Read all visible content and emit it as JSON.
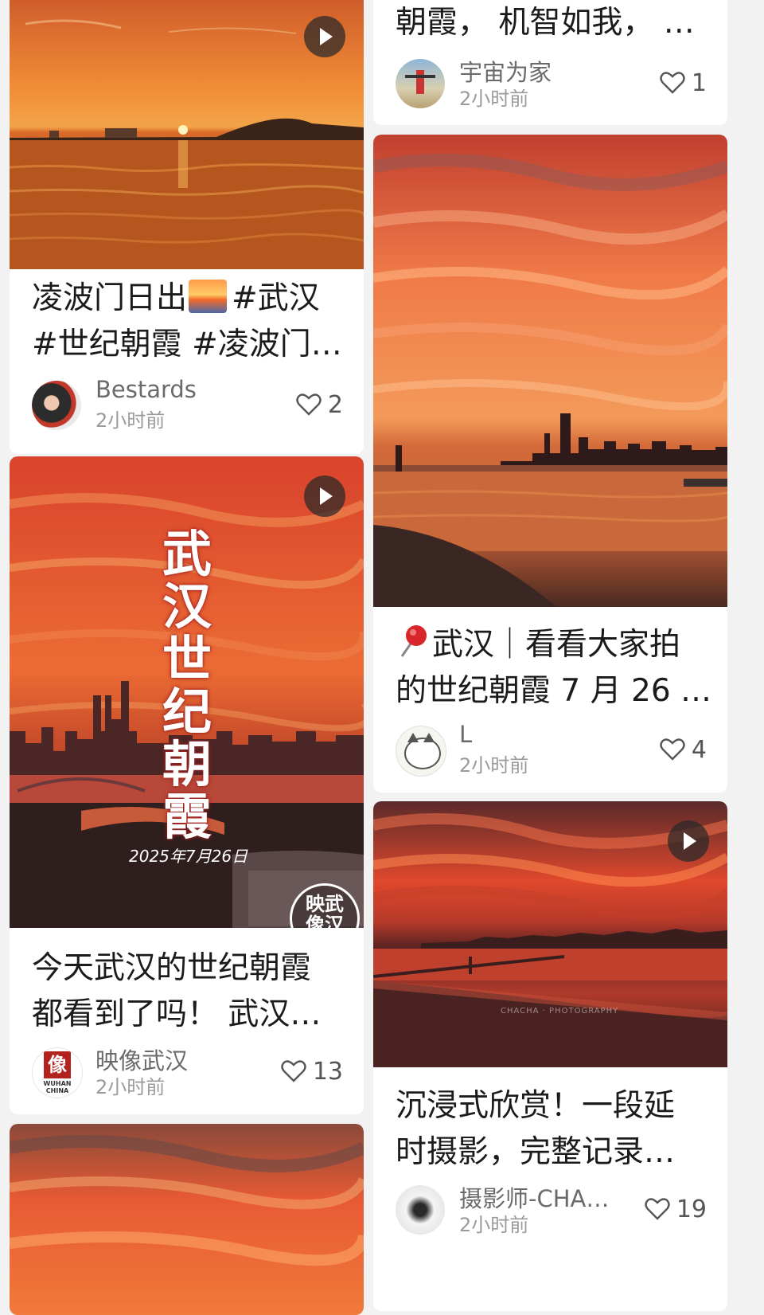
{
  "colors": {
    "background": "#f2f2f2",
    "card": "#ffffff",
    "text": "#1b1b1b",
    "meta": "#9a9a9a"
  },
  "cards": [
    {
      "title_line1": "凌波门日出",
      "title_line1b": "#武汉",
      "title_line2": "#世纪朝霞 #凌波门…",
      "author": "Bestards",
      "time": "2小时前",
      "likes": "2",
      "has_video": true
    },
    {
      "overlay_title": "武汉世纪朝霞",
      "overlay_date": "2025年7月26日",
      "watermark": "映武像汉",
      "title_line1": "今天武汉的世纪朝霞",
      "title_line2": "都看到了吗！ 武汉…",
      "author": "映像武汉",
      "avatar_text": "像",
      "avatar_caption": "WUHAN CHINA",
      "time": "2小时前",
      "likes": "13",
      "has_video": true
    },
    {
      "title_line1": "朝霞， 机智如我， …",
      "author": "宇宙为家",
      "time": "2小时前",
      "likes": "1"
    },
    {
      "title_line1": "武汉｜看看大家拍",
      "title_line2": "的世纪朝霞 7 月 26 …",
      "author": "L",
      "time": "2小时前",
      "likes": "4"
    },
    {
      "photo_watermark": "CHACHA · PHOTOGRAPHY",
      "title_line1": "沉浸式欣赏！一段延",
      "title_line2": "时摄影，完整记录…",
      "author": "摄影师-CHA…",
      "time": "2小时前",
      "likes": "19",
      "has_video": true
    }
  ],
  "icons": {
    "like": "heart-outline-icon",
    "play": "play-icon",
    "pin": "round-pushpin-icon",
    "sun": "sunrise-emoji-icon"
  }
}
